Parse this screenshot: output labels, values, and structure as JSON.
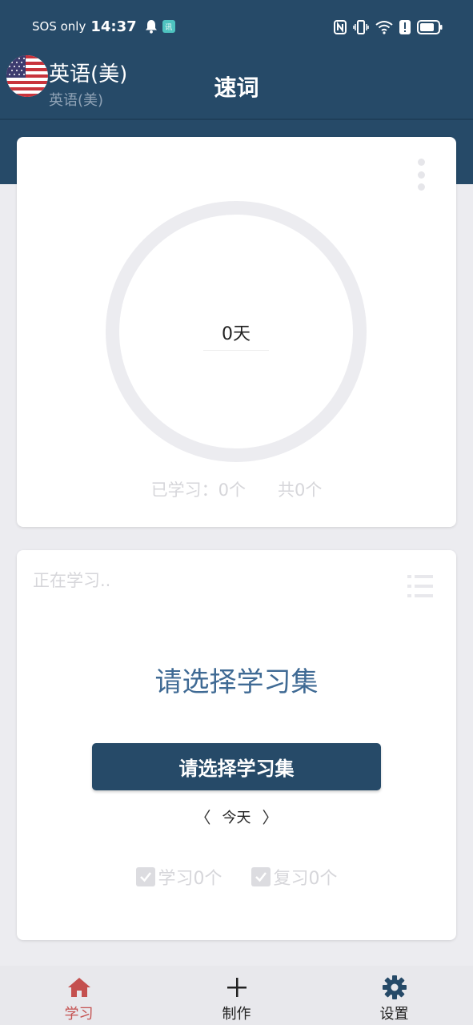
{
  "status_bar": {
    "carrier": "SOS only",
    "time": "14:37",
    "icons": [
      "bell-icon",
      "app-notification-icon",
      "nfc-icon",
      "vibrate-icon",
      "wifi-icon",
      "alert-icon",
      "battery-icon"
    ],
    "badge_text": "讯"
  },
  "header": {
    "language_primary": "英语(美)",
    "language_secondary": "英语(美)",
    "title": "速词",
    "background_color": "#264a68"
  },
  "progress_card": {
    "days": "0天",
    "learned": "已学习：0个",
    "total": "共0个"
  },
  "study_card": {
    "status_label": "正在学习..",
    "prompt_title": "请选择学习集",
    "select_button_label": "请选择学习集",
    "date_prev": "〈",
    "date_label": "今天",
    "date_next": "〉",
    "study_count": "学习0个",
    "review_count": "复习0个"
  },
  "bottom_nav": {
    "items": [
      {
        "label": "学习",
        "icon": "home-icon",
        "active": true
      },
      {
        "label": "制作",
        "icon": "plus-icon",
        "active": false
      },
      {
        "label": "设置",
        "icon": "gear-icon",
        "active": false
      }
    ]
  },
  "colors": {
    "accent_active": "#c4504f",
    "title_blue": "#3f6a94"
  }
}
